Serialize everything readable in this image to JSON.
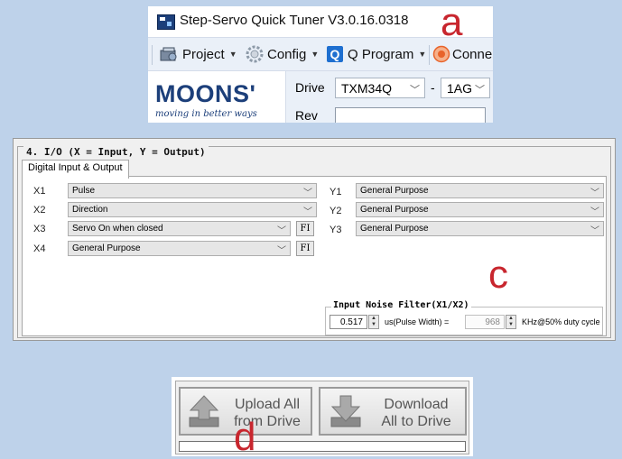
{
  "panel_labels": {
    "a": "a",
    "c": "c",
    "d": "d"
  },
  "app": {
    "title": "Step-Servo Quick Tuner V3.0.16.0318",
    "toolbar": {
      "project": "Project",
      "config": "Config",
      "q_program": "Q Program",
      "connect": "Conne"
    },
    "logo": {
      "brand": "MOONS'",
      "tagline": "moving in better ways"
    },
    "drive_label": "Drive",
    "drive_model": "TXM34Q",
    "separator": "-",
    "drive_variant": "1AG",
    "rev_label": "Rev",
    "rev_value": ""
  },
  "io": {
    "title": "4. I/O (X = Input, Y = Output)",
    "tab": "Digital Input & Output",
    "inputs": [
      {
        "name": "X1",
        "value": "Pulse"
      },
      {
        "name": "X2",
        "value": "Direction"
      },
      {
        "name": "X3",
        "value": "Servo On when closed",
        "fi": "FI"
      },
      {
        "name": "X4",
        "value": "General Purpose",
        "fi": "FI"
      }
    ],
    "outputs": [
      {
        "name": "Y1",
        "value": "General Purpose"
      },
      {
        "name": "Y2",
        "value": "General Purpose"
      },
      {
        "name": "Y3",
        "value": "General Purpose"
      }
    ],
    "noise_filter": {
      "title": "Input Noise Filter(X1/X2)",
      "pulse_width": "0.517",
      "pulse_width_label": "us(Pulse Width) =",
      "frequency": "968",
      "frequency_label": "KHz@50% duty cycle"
    }
  },
  "transfer": {
    "upload": "Upload All from Drive",
    "upload_l1": "Upload All",
    "upload_l2": "from Drive",
    "download_l1": "Download",
    "download_l2": "All to Drive",
    "progress": 0
  },
  "colors": {
    "background": "#bed2ea",
    "brand_blue": "#1c3f7a",
    "label_red": "#c8262e",
    "q_blue": "#1e6fd0",
    "connect_orange": "#e8632a"
  }
}
